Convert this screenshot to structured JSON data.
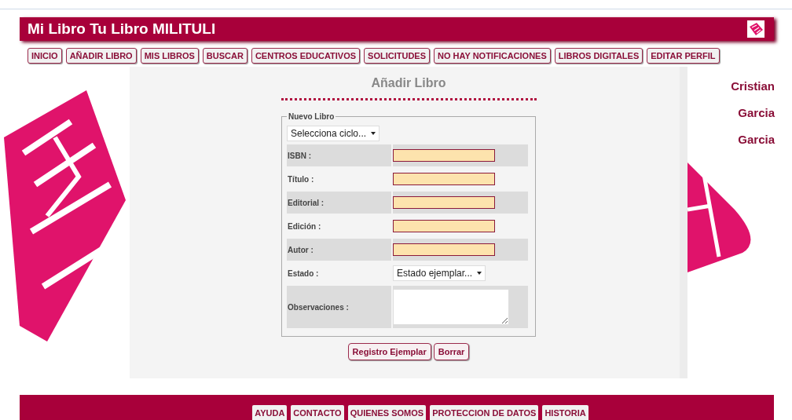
{
  "header": {
    "title": "Mi Libro Tu Libro MILITULI"
  },
  "nav": [
    {
      "label": "INICIO"
    },
    {
      "label": "AÑADIR LIBRO"
    },
    {
      "label": "MIS LIBROS"
    },
    {
      "label": "BUSCAR"
    },
    {
      "label": "CENTROS EDUCATIVOS"
    },
    {
      "label": "SOLICITUDES"
    },
    {
      "label": "NO HAY NOTIFICACIONES"
    },
    {
      "label": "LIBROS DIGITALES"
    },
    {
      "label": "EDITAR PERFIL"
    }
  ],
  "page_title": "Añadir Libro",
  "form": {
    "legend": "Nuevo Libro",
    "cycle_select": "Selecciona ciclo...",
    "fields": [
      {
        "kind": "text",
        "label": "ISBN :"
      },
      {
        "kind": "text",
        "label": "Título :"
      },
      {
        "kind": "text",
        "label": "Editorial :"
      },
      {
        "kind": "text",
        "label": "Edición :"
      },
      {
        "kind": "text",
        "label": "Autor :"
      },
      {
        "kind": "select",
        "label": "Estado :",
        "value": "Estado ejemplar..."
      },
      {
        "kind": "textarea",
        "label": "Observaciones :"
      }
    ],
    "buttons": [
      "Registro Ejemplar",
      "Borrar"
    ]
  },
  "user": [
    "Cristian",
    "Garcia",
    "Garcia"
  ],
  "footer": [
    {
      "label": "AYUDA"
    },
    {
      "label": "CONTACTO"
    },
    {
      "label": "QUIENES SOMOS"
    },
    {
      "label": "PROTECCION DE DATOS"
    },
    {
      "label": "HISTORIA"
    }
  ]
}
